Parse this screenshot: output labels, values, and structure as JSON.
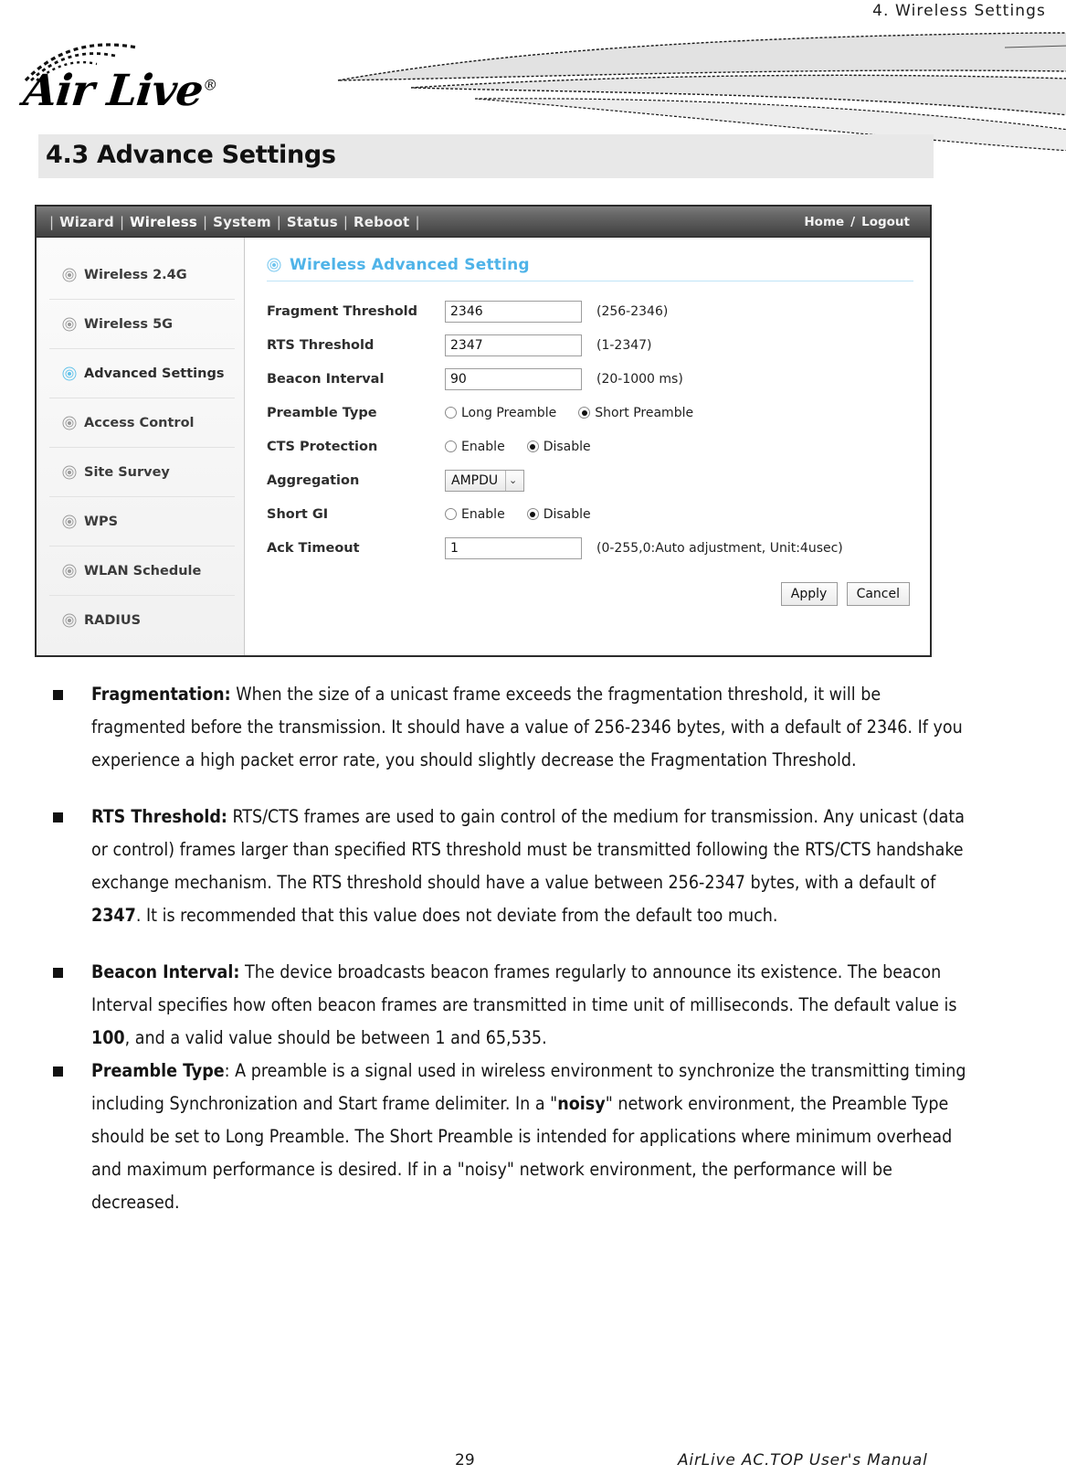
{
  "page": {
    "running_head": "4.  Wireless  Settings",
    "section_title": "4.3 Advance Settings",
    "logo_text": "Air Live",
    "logo_registered": "®",
    "footer_page_number": "29",
    "footer_manual": "AirLive  AC.TOP  User's  Manual"
  },
  "router_ui": {
    "nav": {
      "sep": "|",
      "items": [
        {
          "label": "Wizard",
          "active": false
        },
        {
          "label": "Wireless",
          "active": true
        },
        {
          "label": "System",
          "active": false
        },
        {
          "label": "Status",
          "active": false
        },
        {
          "label": "Reboot",
          "active": false
        }
      ],
      "home_label": "Home",
      "divider": "/",
      "logout_label": "Logout"
    },
    "sidebar": {
      "items": [
        {
          "label": "Wireless 2.4G",
          "active": false
        },
        {
          "label": "Wireless 5G",
          "active": false
        },
        {
          "label": "Advanced Settings",
          "active": true
        },
        {
          "label": "Access Control",
          "active": false
        },
        {
          "label": "Site Survey",
          "active": false
        },
        {
          "label": "WPS",
          "active": false
        },
        {
          "label": "WLAN Schedule",
          "active": false
        },
        {
          "label": "RADIUS",
          "active": false
        }
      ]
    },
    "panel": {
      "title": "Wireless Advanced Setting",
      "title_color": "#4fb3e8",
      "fields": {
        "fragment_threshold": {
          "label": "Fragment Threshold",
          "value": "2346",
          "hint": "(256-2346)"
        },
        "rts_threshold": {
          "label": "RTS Threshold",
          "value": "2347",
          "hint": "(1-2347)"
        },
        "beacon_interval": {
          "label": "Beacon Interval",
          "value": "90",
          "hint": "(20-1000 ms)"
        },
        "preamble_type": {
          "label": "Preamble Type",
          "option_long": "Long Preamble",
          "option_short": "Short Preamble",
          "selected": "Short Preamble"
        },
        "cts_protection": {
          "label": "CTS Protection",
          "option_enable": "Enable",
          "option_disable": "Disable",
          "selected": "Disable"
        },
        "aggregation": {
          "label": "Aggregation",
          "value": "AMPDU",
          "caret": "⌄"
        },
        "short_gi": {
          "label": "Short GI",
          "option_enable": "Enable",
          "option_disable": "Disable",
          "selected": "Disable"
        },
        "ack_timeout": {
          "label": "Ack Timeout",
          "value": "1",
          "hint": "(0-255,0:Auto adjustment, Unit:4usec)"
        }
      },
      "apply_label": "Apply",
      "cancel_label": "Cancel"
    }
  },
  "bullets": [
    {
      "term": "Fragmentation:",
      "term_trailing_space": " ",
      "text": "When the size of a unicast frame exceeds the fragmentation threshold, it will be fragmented before the transmission. It should have a value of 256-2346 bytes, with a default of 2346.    If you experience a high packet error rate, you should slightly decrease the Fragmentation Threshold."
    },
    {
      "term": "RTS Threshold:",
      "term_trailing_space": " ",
      "text_a": "RTS/CTS frames are used to gain control of the medium for transmission. Any unicast (data or control) frames larger than specified RTS threshold must be transmitted following the RTS/CTS handshake exchange mechanism. The RTS threshold should have a value between 256-2347 bytes, with a default of ",
      "emphasis": "2347",
      "text_b": ". It is recommended that this value does not deviate from the default too much."
    },
    {
      "term": "Beacon Interval:",
      "term_trailing_space": " ",
      "text_a": "The device broadcasts beacon frames regularly to announce its existence. The beacon Interval specifies how often beacon frames are transmitted in time unit of milliseconds. The default value is ",
      "emphasis": "100",
      "text_b": ", and a valid value should be between 1 and 65,535."
    },
    {
      "term": "Preamble Type",
      "term_trailing_space": "",
      "text_a": ": A preamble is a signal used in wireless environment to synchronize the transmitting timing including Synchronization and Start frame delimiter. In a \"",
      "emphasis": "noisy",
      "text_b": "\" network environment, the Preamble Type should be set to Long Preamble. The Short Preamble is intended for applications where minimum overhead and maximum performance is desired. If in a \"noisy\" network environment, the performance will be decreased."
    }
  ]
}
